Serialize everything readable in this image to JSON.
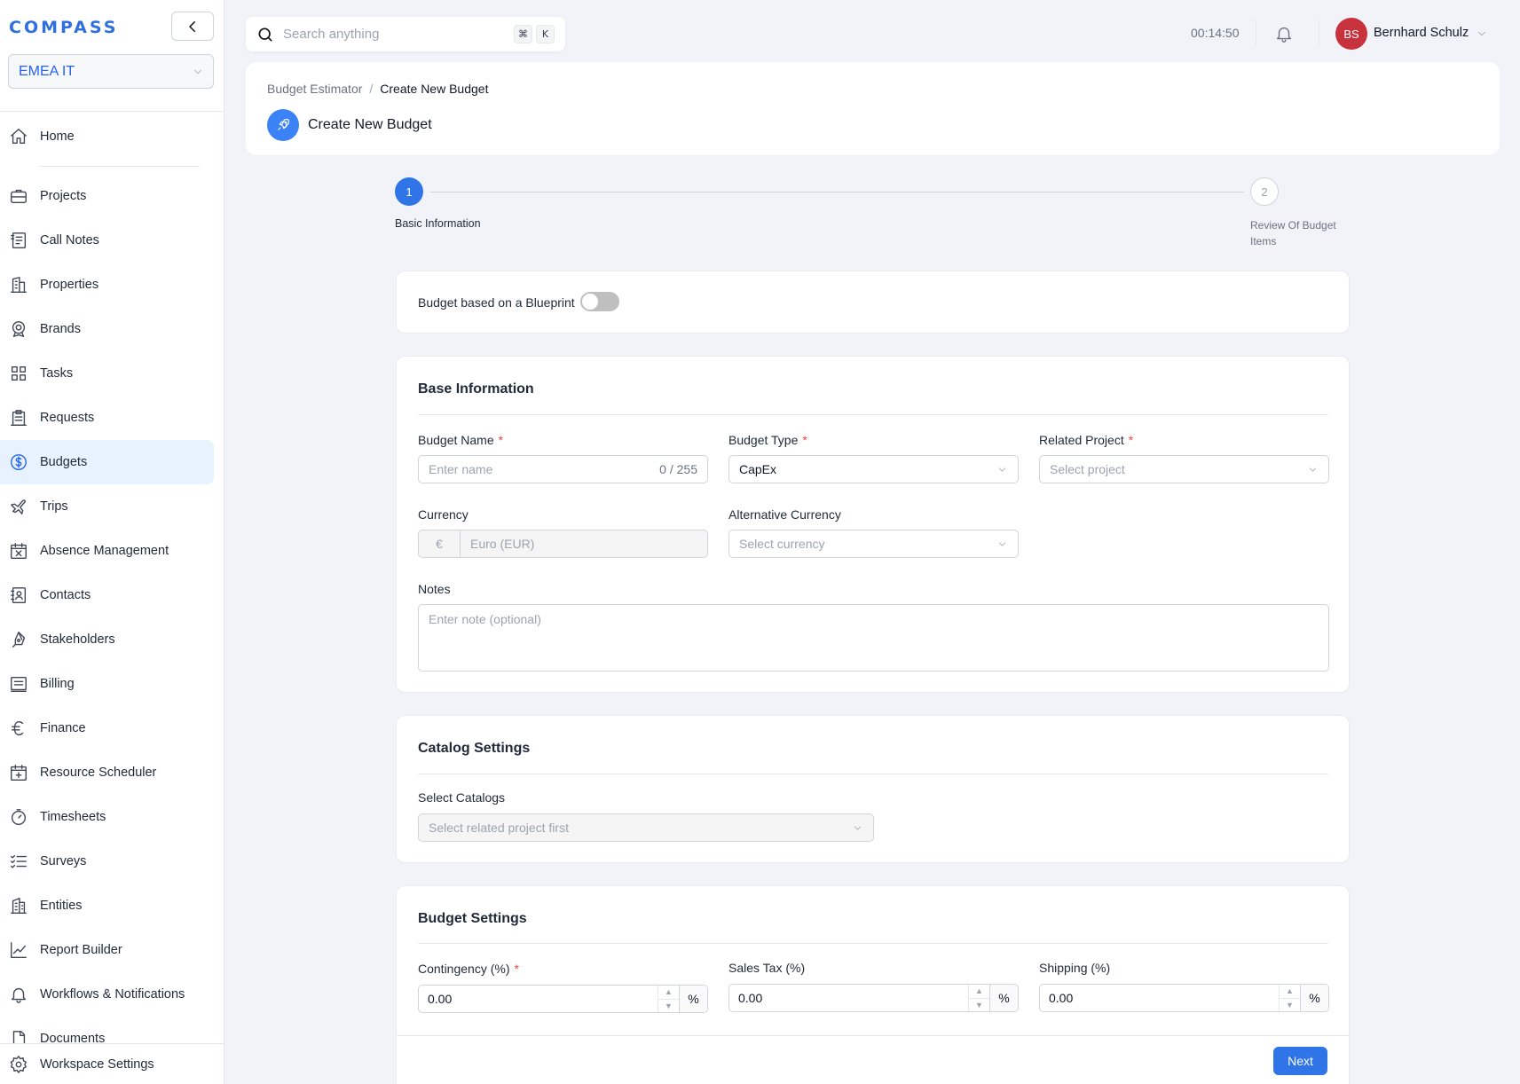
{
  "app": {
    "logo": "COMPASS"
  },
  "sidebar": {
    "workspace": "EMEA IT",
    "items": [
      {
        "label": "Home"
      },
      {
        "label": "Projects"
      },
      {
        "label": "Call Notes"
      },
      {
        "label": "Properties"
      },
      {
        "label": "Brands"
      },
      {
        "label": "Tasks"
      },
      {
        "label": "Requests"
      },
      {
        "label": "Budgets",
        "active": true
      },
      {
        "label": "Trips"
      },
      {
        "label": "Absence Management"
      },
      {
        "label": "Contacts"
      },
      {
        "label": "Stakeholders"
      },
      {
        "label": "Billing"
      },
      {
        "label": "Finance"
      },
      {
        "label": "Resource Scheduler"
      },
      {
        "label": "Timesheets"
      },
      {
        "label": "Surveys"
      },
      {
        "label": "Entities"
      },
      {
        "label": "Report Builder"
      },
      {
        "label": "Workflows & Notifications"
      },
      {
        "label": "Documents"
      }
    ],
    "bottom": "Workspace Settings"
  },
  "topbar": {
    "search_placeholder": "Search anything",
    "kbd_cmd": "⌘",
    "kbd_k": "K",
    "timer": "00:14:50",
    "user_initials": "BS",
    "user_name": "Bernhard Schulz",
    "avatar_color": "#c8323d"
  },
  "header": {
    "breadcrumb_parent": "Budget Estimator",
    "breadcrumb_sep": "/",
    "breadcrumb_current": "Create New Budget",
    "title": "Create New Budget"
  },
  "stepper": {
    "steps": [
      {
        "number": "1",
        "label": "Basic Information",
        "active": true
      },
      {
        "number": "2",
        "label": "Review Of Budget Items",
        "active": false
      }
    ]
  },
  "blueprint": {
    "label": "Budget based on a Blueprint",
    "enabled": false
  },
  "base_info": {
    "title": "Base Information",
    "budget_name": {
      "label": "Budget Name",
      "placeholder": "Enter name",
      "counter": "0 / 255"
    },
    "budget_type": {
      "label": "Budget Type",
      "value": "CapEx"
    },
    "related_project": {
      "label": "Related Project",
      "placeholder": "Select project"
    },
    "currency": {
      "label": "Currency",
      "symbol": "€",
      "value": "Euro (EUR)"
    },
    "alt_currency": {
      "label": "Alternative Currency",
      "placeholder": "Select currency"
    },
    "notes": {
      "label": "Notes",
      "placeholder": "Enter note (optional)"
    },
    "required_mark": "*"
  },
  "catalog": {
    "title": "Catalog Settings",
    "label": "Select Catalogs",
    "placeholder": "Select related project first"
  },
  "budget_settings": {
    "title": "Budget Settings",
    "contingency": {
      "label": "Contingency (%)",
      "value": "0.00",
      "suffix": "%"
    },
    "sales_tax": {
      "label": "Sales Tax (%)",
      "value": "0.00",
      "suffix": "%"
    },
    "shipping": {
      "label": "Shipping (%)",
      "value": "0.00",
      "suffix": "%"
    }
  },
  "actions": {
    "next": "Next"
  },
  "colors": {
    "accent": "#2f75e8",
    "active_bg": "#e8f2fe",
    "required": "#ef4444"
  }
}
